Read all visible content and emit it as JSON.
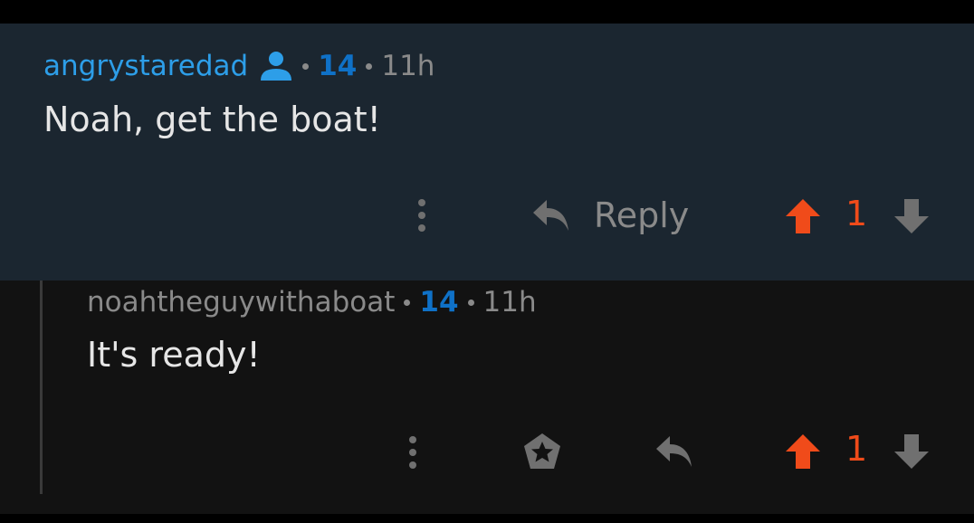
{
  "comments": [
    {
      "author": "angrystaredad",
      "score": "14",
      "age": "11h",
      "body": "Noah, get the boat!",
      "reply_label": "Reply",
      "vote_count": "1"
    },
    {
      "author": "noahtheguywithaboat",
      "score": "14",
      "age": "11h",
      "body": "It's ready!",
      "vote_count": "1"
    }
  ],
  "icons": {
    "op_badge": "user-icon",
    "more": "more-vertical-icon",
    "reply": "reply-icon",
    "award": "award-icon",
    "upvote": "upvote-arrow-icon",
    "downvote": "downvote-arrow-icon"
  },
  "colors": {
    "highlight_bg": "#1b2630",
    "reply_bg": "#121212",
    "op_author": "#2d9ee8",
    "score": "#0f71c7",
    "upvoted": "#f04b1a",
    "muted": "#8a8a8a"
  }
}
